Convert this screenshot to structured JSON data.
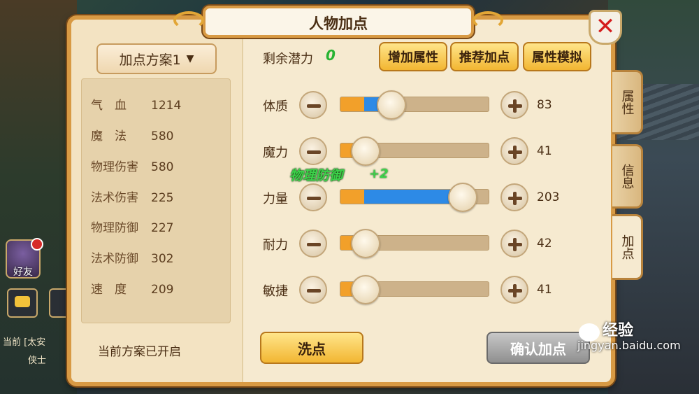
{
  "dialog": {
    "title": "人物加点",
    "close_symbol": "✕"
  },
  "scheme": {
    "selected": "加点方案1",
    "chevron": "⌄",
    "status": "当前方案已开启"
  },
  "stats": [
    {
      "name": "气　血",
      "value": "1214"
    },
    {
      "name": "魔　法",
      "value": "580"
    },
    {
      "name": "物理伤害",
      "value": "580"
    },
    {
      "name": "法术伤害",
      "value": "225"
    },
    {
      "name": "物理防御",
      "value": "227"
    },
    {
      "name": "法术防御",
      "value": "302"
    },
    {
      "name": "速　度",
      "value": "209"
    }
  ],
  "potential": {
    "label": "剩余潜力",
    "value": "0"
  },
  "buttons": {
    "add_attribute": "增加属性",
    "recommend": "推荐加点",
    "simulate": "属性模拟",
    "wash": "洗点",
    "confirm": "确认加点"
  },
  "attributes": [
    {
      "label": "体质",
      "value": "83",
      "fill_fraction": 0.33
    },
    {
      "label": "魔力",
      "value": "41",
      "fill_fraction": 0.16
    },
    {
      "label": "力量",
      "value": "203",
      "fill_fraction": 0.81
    },
    {
      "label": "耐力",
      "value": "42",
      "fill_fraction": 0.16
    },
    {
      "label": "敏捷",
      "value": "41",
      "fill_fraction": 0.16
    }
  ],
  "floating_bonus": {
    "label": "物理防御",
    "value": "+2"
  },
  "side_tabs": [
    {
      "label": "属性"
    },
    {
      "label": "信息"
    },
    {
      "label": "加点"
    }
  ],
  "background": {
    "friends_label": "好友",
    "chat_lines": [
      "[太安",
      "侠士"
    ],
    "chat_channel": "当前"
  },
  "watermark": {
    "brand": "经验",
    "url": "jingyan.baidu.com"
  },
  "colors": {
    "panel_bg": "#f6ead0",
    "frame": "#d89a44",
    "button_gold": "#f2b632",
    "slider_base": "#f2a02a",
    "slider_added": "#2d8ae6",
    "bonus_green": "#3cd14a",
    "close_red": "#d41c1c"
  },
  "icons": [
    "close-icon",
    "chevron-down-icon",
    "minus-icon",
    "plus-icon",
    "chat-icon",
    "mic-icon",
    "paw-icon"
  ]
}
